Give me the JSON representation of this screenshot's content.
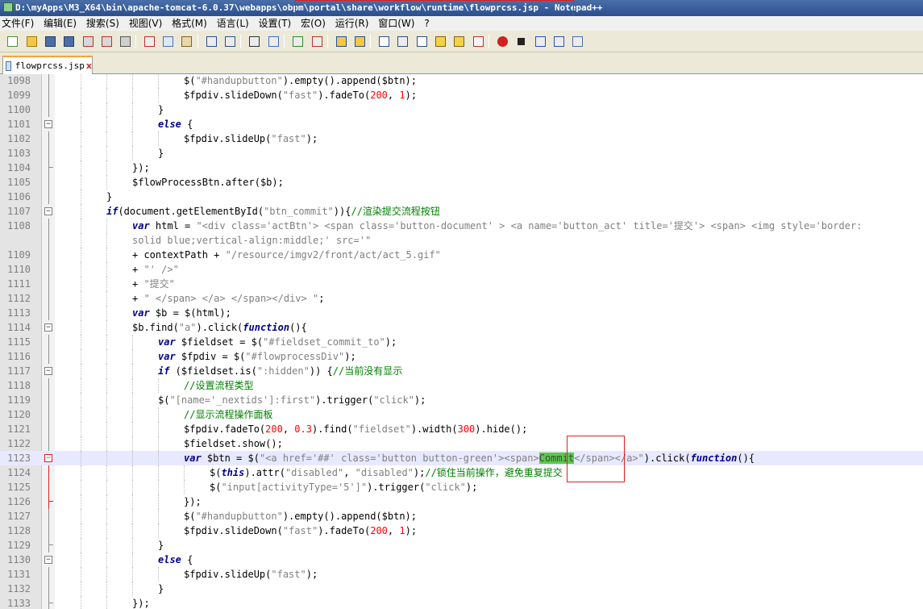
{
  "window": {
    "title": "D:\\myApps\\M3_X64\\bin\\apache-tomcat-6.0.37\\webapps\\obpm\\portal\\share\\workflow\\runtime\\flowprcss.jsp - Notepad++"
  },
  "menu": {
    "items": [
      "文件(F)",
      "编辑(E)",
      "搜索(S)",
      "视图(V)",
      "格式(M)",
      "语言(L)",
      "设置(T)",
      "宏(O)",
      "运行(R)",
      "窗口(W)"
    ],
    "help": "?"
  },
  "toolbar": {
    "buttons": [
      "new-file-icon",
      "open-file-icon",
      "save-icon",
      "save-all-icon",
      "close-icon",
      "close-all-icon",
      "print-icon",
      "cut-icon",
      "copy-icon",
      "paste-icon",
      "undo-icon",
      "redo-icon",
      "find-icon",
      "replace-icon",
      "zoom-in-icon",
      "zoom-out-icon",
      "sync-vertical-icon",
      "sync-horizontal-icon",
      "word-wrap-icon",
      "show-all-chars-icon",
      "indent-guide-icon",
      "user-lang-icon",
      "doc-map-icon",
      "function-list-icon",
      "record-macro-icon",
      "stop-record-icon",
      "play-macro-icon",
      "run-macro-multiple-icon",
      "save-macro-icon"
    ]
  },
  "tab": {
    "label": "flowprcss.jsp",
    "close": "x"
  },
  "colors": {
    "keyword": "#00008b",
    "string": "#808080",
    "number": "#ff0000",
    "comment": "#008000",
    "selection": "#5aca4a",
    "highlight_box": "#e02020"
  },
  "lines": [
    {
      "n": "1098",
      "i": 5,
      "t": [
        [
          "p",
          "$("
        ],
        [
          "s",
          "\"#handupbutton\""
        ],
        [
          "p",
          ").empty().append($btn);"
        ]
      ]
    },
    {
      "n": "1099",
      "i": 5,
      "t": [
        [
          "p",
          "$fpdiv.slideDown("
        ],
        [
          "s",
          "\"fast\""
        ],
        [
          "p",
          ").fadeTo("
        ],
        [
          "n",
          "200"
        ],
        [
          "p",
          ", "
        ],
        [
          "n",
          "1"
        ],
        [
          "p",
          ");"
        ]
      ]
    },
    {
      "n": "1100",
      "i": 4,
      "t": [
        [
          "p",
          "}"
        ]
      ]
    },
    {
      "n": "1101",
      "i": 4,
      "t": [
        [
          "k",
          "else"
        ],
        [
          "p",
          " {"
        ]
      ]
    },
    {
      "n": "1102",
      "i": 5,
      "t": [
        [
          "p",
          "$fpdiv.slideUp("
        ],
        [
          "s",
          "\"fast\""
        ],
        [
          "p",
          ");"
        ]
      ]
    },
    {
      "n": "1103",
      "i": 4,
      "t": [
        [
          "p",
          "}"
        ]
      ]
    },
    {
      "n": "1104",
      "i": 3,
      "t": [
        [
          "p",
          "});"
        ]
      ]
    },
    {
      "n": "1105",
      "i": 3,
      "t": [
        [
          "p",
          "$flowProcessBtn.after($b);"
        ]
      ]
    },
    {
      "n": "1106",
      "i": 2,
      "t": [
        [
          "p",
          "}"
        ]
      ]
    },
    {
      "n": "1107",
      "i": 2,
      "t": [
        [
          "k",
          "if"
        ],
        [
          "p",
          "(document.getElementById("
        ],
        [
          "s",
          "\"btn_commit\""
        ],
        [
          "p",
          ")){"
        ],
        [
          "c",
          "//渲染提交流程按钮"
        ]
      ]
    },
    {
      "n": "1108",
      "i": 3,
      "t": [
        [
          "k",
          "var"
        ],
        [
          "p",
          " html = "
        ],
        [
          "s",
          "\"<div class='actBtn'> <span class='button-document' > <a name='button_act' title='提交'> <span> <img style='border:"
        ]
      ]
    },
    {
      "n": "",
      "i": 3,
      "t": [
        [
          "s",
          "solid blue;vertical-align:middle;' src='\""
        ]
      ]
    },
    {
      "n": "1109",
      "i": 3,
      "t": [
        [
          "p",
          "+ contextPath + "
        ],
        [
          "s",
          "\"/resource/imgv2/front/act/act_5.gif\""
        ]
      ]
    },
    {
      "n": "1110",
      "i": 3,
      "t": [
        [
          "p",
          "+ "
        ],
        [
          "s",
          "\"' />\""
        ]
      ]
    },
    {
      "n": "1111",
      "i": 3,
      "t": [
        [
          "p",
          "+ "
        ],
        [
          "s",
          "\"提交\""
        ]
      ]
    },
    {
      "n": "1112",
      "i": 3,
      "t": [
        [
          "p",
          "+ "
        ],
        [
          "s",
          "\" </span> </a> </span></div> \""
        ],
        [
          "p",
          ";"
        ]
      ]
    },
    {
      "n": "1113",
      "i": 3,
      "t": [
        [
          "k",
          "var"
        ],
        [
          "p",
          " $b = $(html);"
        ]
      ]
    },
    {
      "n": "1114",
      "i": 3,
      "t": [
        [
          "p",
          "$b.find("
        ],
        [
          "s",
          "\"a\""
        ],
        [
          "p",
          ").click("
        ],
        [
          "k",
          "function"
        ],
        [
          "p",
          "(){"
        ]
      ]
    },
    {
      "n": "1115",
      "i": 4,
      "t": [
        [
          "k",
          "var"
        ],
        [
          "p",
          " $fieldset = $("
        ],
        [
          "s",
          "\"#fieldset_commit_to\""
        ],
        [
          "p",
          ");"
        ]
      ]
    },
    {
      "n": "1116",
      "i": 4,
      "t": [
        [
          "k",
          "var"
        ],
        [
          "p",
          " $fpdiv = $("
        ],
        [
          "s",
          "\"#flowprocessDiv\""
        ],
        [
          "p",
          ");"
        ]
      ]
    },
    {
      "n": "1117",
      "i": 4,
      "t": [
        [
          "k",
          "if"
        ],
        [
          "p",
          " ($fieldset.is("
        ],
        [
          "s",
          "\":hidden\""
        ],
        [
          "p",
          ")) {"
        ],
        [
          "c",
          "//当前没有显示"
        ]
      ]
    },
    {
      "n": "1118",
      "i": 5,
      "t": [
        [
          "c",
          "//设置流程类型"
        ]
      ]
    },
    {
      "n": "1119",
      "i": 4,
      "t": [
        [
          "p",
          "$("
        ],
        [
          "s",
          "\"[name='_nextids']:first\""
        ],
        [
          "p",
          ").trigger("
        ],
        [
          "s",
          "\"click\""
        ],
        [
          "p",
          ");"
        ]
      ]
    },
    {
      "n": "1120",
      "i": 5,
      "t": [
        [
          "c",
          "//显示流程操作面板"
        ]
      ]
    },
    {
      "n": "1121",
      "i": 5,
      "t": [
        [
          "p",
          "$fpdiv.fadeTo("
        ],
        [
          "n",
          "200"
        ],
        [
          "p",
          ", "
        ],
        [
          "n",
          "0.3"
        ],
        [
          "p",
          ").find("
        ],
        [
          "s",
          "\"fieldset\""
        ],
        [
          "p",
          ").width("
        ],
        [
          "n",
          "300"
        ],
        [
          "p",
          ").hide();"
        ]
      ]
    },
    {
      "n": "1122",
      "i": 5,
      "t": [
        [
          "p",
          "$fieldset.show();"
        ]
      ]
    },
    {
      "n": "1123",
      "i": 5,
      "t": [
        [
          "k",
          "var"
        ],
        [
          "p",
          " $btn = $("
        ],
        [
          "s",
          "\"<a href='##' class='button button-green'><span>"
        ],
        [
          "h",
          "Commit"
        ],
        [
          "s",
          "</span></a>\""
        ],
        [
          "p",
          ").click("
        ],
        [
          "k",
          "function"
        ],
        [
          "p",
          "(){"
        ]
      ]
    },
    {
      "n": "1124",
      "i": 6,
      "t": [
        [
          "p",
          "$("
        ],
        [
          "k",
          "this"
        ],
        [
          "p",
          ").attr("
        ],
        [
          "s",
          "\"disabled\""
        ],
        [
          "p",
          ", "
        ],
        [
          "s",
          "\"disabled\""
        ],
        [
          "p",
          ");"
        ],
        [
          "c",
          "//锁住当前操作，避免重复提交"
        ]
      ]
    },
    {
      "n": "1125",
      "i": 6,
      "t": [
        [
          "p",
          "$("
        ],
        [
          "s",
          "\"input[activityType='5']\""
        ],
        [
          "p",
          ").trigger("
        ],
        [
          "s",
          "\"click\""
        ],
        [
          "p",
          ");"
        ]
      ]
    },
    {
      "n": "1126",
      "i": 5,
      "t": [
        [
          "p",
          "});"
        ]
      ]
    },
    {
      "n": "1127",
      "i": 5,
      "t": [
        [
          "p",
          "$("
        ],
        [
          "s",
          "\"#handupbutton\""
        ],
        [
          "p",
          ").empty().append($btn);"
        ]
      ]
    },
    {
      "n": "1128",
      "i": 5,
      "t": [
        [
          "p",
          "$fpdiv.slideDown("
        ],
        [
          "s",
          "\"fast\""
        ],
        [
          "p",
          ").fadeTo("
        ],
        [
          "n",
          "200"
        ],
        [
          "p",
          ", "
        ],
        [
          "n",
          "1"
        ],
        [
          "p",
          ");"
        ]
      ]
    },
    {
      "n": "1129",
      "i": 4,
      "t": [
        [
          "p",
          "}"
        ]
      ]
    },
    {
      "n": "1130",
      "i": 4,
      "t": [
        [
          "k",
          "else"
        ],
        [
          "p",
          " {"
        ]
      ]
    },
    {
      "n": "1131",
      "i": 5,
      "t": [
        [
          "p",
          "$fpdiv.slideUp("
        ],
        [
          "s",
          "\"fast\""
        ],
        [
          "p",
          ");"
        ]
      ]
    },
    {
      "n": "1132",
      "i": 4,
      "t": [
        [
          "p",
          "}"
        ]
      ]
    },
    {
      "n": "1133",
      "i": 3,
      "t": [
        [
          "p",
          "});"
        ]
      ]
    }
  ]
}
